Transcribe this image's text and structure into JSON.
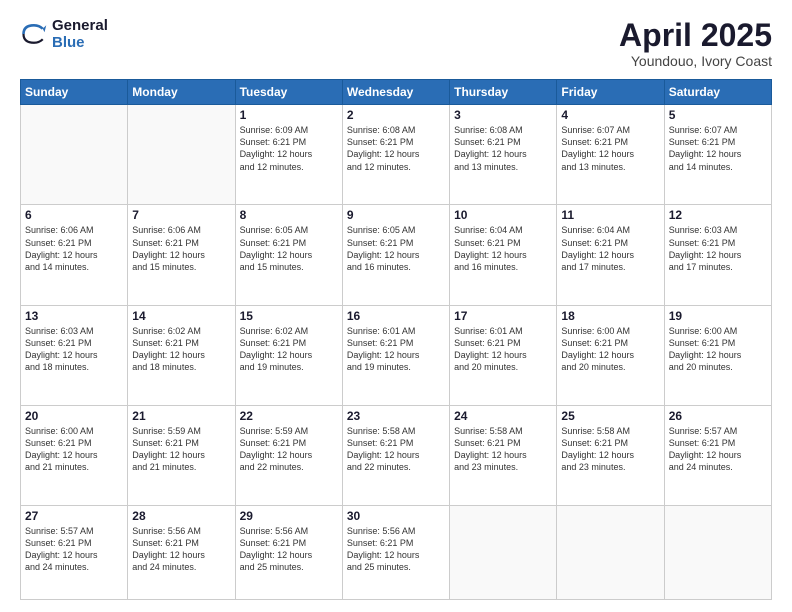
{
  "logo": {
    "general": "General",
    "blue": "Blue"
  },
  "header": {
    "title": "April 2025",
    "subtitle": "Youndouo, Ivory Coast"
  },
  "weekdays": [
    "Sunday",
    "Monday",
    "Tuesday",
    "Wednesday",
    "Thursday",
    "Friday",
    "Saturday"
  ],
  "weeks": [
    [
      {
        "day": "",
        "info": ""
      },
      {
        "day": "",
        "info": ""
      },
      {
        "day": "1",
        "info": "Sunrise: 6:09 AM\nSunset: 6:21 PM\nDaylight: 12 hours\nand 12 minutes."
      },
      {
        "day": "2",
        "info": "Sunrise: 6:08 AM\nSunset: 6:21 PM\nDaylight: 12 hours\nand 12 minutes."
      },
      {
        "day": "3",
        "info": "Sunrise: 6:08 AM\nSunset: 6:21 PM\nDaylight: 12 hours\nand 13 minutes."
      },
      {
        "day": "4",
        "info": "Sunrise: 6:07 AM\nSunset: 6:21 PM\nDaylight: 12 hours\nand 13 minutes."
      },
      {
        "day": "5",
        "info": "Sunrise: 6:07 AM\nSunset: 6:21 PM\nDaylight: 12 hours\nand 14 minutes."
      }
    ],
    [
      {
        "day": "6",
        "info": "Sunrise: 6:06 AM\nSunset: 6:21 PM\nDaylight: 12 hours\nand 14 minutes."
      },
      {
        "day": "7",
        "info": "Sunrise: 6:06 AM\nSunset: 6:21 PM\nDaylight: 12 hours\nand 15 minutes."
      },
      {
        "day": "8",
        "info": "Sunrise: 6:05 AM\nSunset: 6:21 PM\nDaylight: 12 hours\nand 15 minutes."
      },
      {
        "day": "9",
        "info": "Sunrise: 6:05 AM\nSunset: 6:21 PM\nDaylight: 12 hours\nand 16 minutes."
      },
      {
        "day": "10",
        "info": "Sunrise: 6:04 AM\nSunset: 6:21 PM\nDaylight: 12 hours\nand 16 minutes."
      },
      {
        "day": "11",
        "info": "Sunrise: 6:04 AM\nSunset: 6:21 PM\nDaylight: 12 hours\nand 17 minutes."
      },
      {
        "day": "12",
        "info": "Sunrise: 6:03 AM\nSunset: 6:21 PM\nDaylight: 12 hours\nand 17 minutes."
      }
    ],
    [
      {
        "day": "13",
        "info": "Sunrise: 6:03 AM\nSunset: 6:21 PM\nDaylight: 12 hours\nand 18 minutes."
      },
      {
        "day": "14",
        "info": "Sunrise: 6:02 AM\nSunset: 6:21 PM\nDaylight: 12 hours\nand 18 minutes."
      },
      {
        "day": "15",
        "info": "Sunrise: 6:02 AM\nSunset: 6:21 PM\nDaylight: 12 hours\nand 19 minutes."
      },
      {
        "day": "16",
        "info": "Sunrise: 6:01 AM\nSunset: 6:21 PM\nDaylight: 12 hours\nand 19 minutes."
      },
      {
        "day": "17",
        "info": "Sunrise: 6:01 AM\nSunset: 6:21 PM\nDaylight: 12 hours\nand 20 minutes."
      },
      {
        "day": "18",
        "info": "Sunrise: 6:00 AM\nSunset: 6:21 PM\nDaylight: 12 hours\nand 20 minutes."
      },
      {
        "day": "19",
        "info": "Sunrise: 6:00 AM\nSunset: 6:21 PM\nDaylight: 12 hours\nand 20 minutes."
      }
    ],
    [
      {
        "day": "20",
        "info": "Sunrise: 6:00 AM\nSunset: 6:21 PM\nDaylight: 12 hours\nand 21 minutes."
      },
      {
        "day": "21",
        "info": "Sunrise: 5:59 AM\nSunset: 6:21 PM\nDaylight: 12 hours\nand 21 minutes."
      },
      {
        "day": "22",
        "info": "Sunrise: 5:59 AM\nSunset: 6:21 PM\nDaylight: 12 hours\nand 22 minutes."
      },
      {
        "day": "23",
        "info": "Sunrise: 5:58 AM\nSunset: 6:21 PM\nDaylight: 12 hours\nand 22 minutes."
      },
      {
        "day": "24",
        "info": "Sunrise: 5:58 AM\nSunset: 6:21 PM\nDaylight: 12 hours\nand 23 minutes."
      },
      {
        "day": "25",
        "info": "Sunrise: 5:58 AM\nSunset: 6:21 PM\nDaylight: 12 hours\nand 23 minutes."
      },
      {
        "day": "26",
        "info": "Sunrise: 5:57 AM\nSunset: 6:21 PM\nDaylight: 12 hours\nand 24 minutes."
      }
    ],
    [
      {
        "day": "27",
        "info": "Sunrise: 5:57 AM\nSunset: 6:21 PM\nDaylight: 12 hours\nand 24 minutes."
      },
      {
        "day": "28",
        "info": "Sunrise: 5:56 AM\nSunset: 6:21 PM\nDaylight: 12 hours\nand 24 minutes."
      },
      {
        "day": "29",
        "info": "Sunrise: 5:56 AM\nSunset: 6:21 PM\nDaylight: 12 hours\nand 25 minutes."
      },
      {
        "day": "30",
        "info": "Sunrise: 5:56 AM\nSunset: 6:21 PM\nDaylight: 12 hours\nand 25 minutes."
      },
      {
        "day": "",
        "info": ""
      },
      {
        "day": "",
        "info": ""
      },
      {
        "day": "",
        "info": ""
      }
    ]
  ]
}
